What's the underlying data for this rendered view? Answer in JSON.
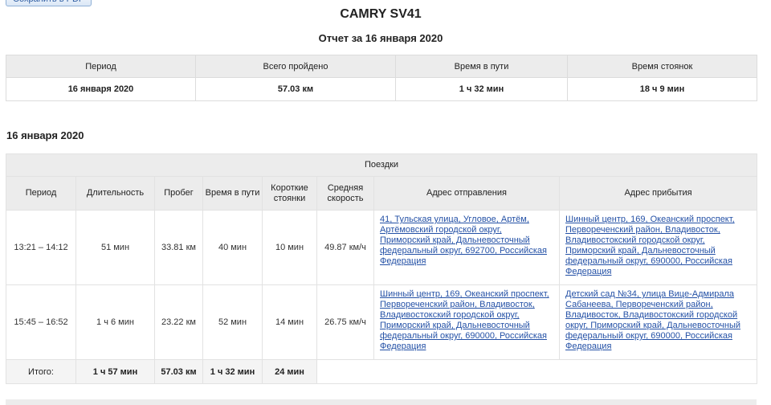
{
  "toolbar": {
    "pdf_button": "Сохранить в PDF"
  },
  "report": {
    "title": "CAMRY SV41",
    "subtitle": "Отчет за 16 января 2020"
  },
  "summary": {
    "headers": [
      "Период",
      "Всего пройдено",
      "Время в пути",
      "Время стоянок"
    ],
    "values": [
      "16 января 2020",
      "57.03 км",
      "1 ч 32 мин",
      "18 ч 9 мин"
    ]
  },
  "day": {
    "heading": "16 января 2020",
    "caption": "Поездки",
    "headers": [
      "Период",
      "Длительность",
      "Пробег",
      "Время в пути",
      "Короткие стоянки",
      "Средняя скорость",
      "Адрес отправления",
      "Адрес прибытия"
    ],
    "trips": [
      {
        "period": "13:21 – 14:12",
        "duration": "51 мин",
        "distance": "33.81 км",
        "drive_time": "40 мин",
        "short_stops": "10 мин",
        "avg_speed": "49.87 км/ч",
        "from": "41, Тульская улица, Угловое, Артём, Артёмовский городской округ, Приморский край, Дальневосточный федеральный округ, 692700, Российская Федерация",
        "to": "Шинный центр, 169, Океанский проспект, Первореченский район, Владивосток, Владивостокский городской округ, Приморский край, Дальневосточный федеральный округ, 690000, Российская Федерация"
      },
      {
        "period": "15:45 – 16:52",
        "duration": "1 ч 6 мин",
        "distance": "23.22 км",
        "drive_time": "52 мин",
        "short_stops": "14 мин",
        "avg_speed": "26.75 км/ч",
        "from": "Шинный центр, 169, Океанский проспект, Первореченский район, Владивосток, Владивостокский городской округ, Приморский край, Дальневосточный федеральный округ, 690000, Российская Федерация",
        "to": "Детский сад №34, улица Вице-Адмирала Сабанеева, Первореченский район, Владивосток, Владивостокский городской округ, Приморский край, Дальневосточный федеральный округ, 690000, Российская Федерация"
      }
    ],
    "totals": {
      "label": "Итого:",
      "duration": "1 ч 57 мин",
      "distance": "57.03 км",
      "drive_time": "1 ч 32 мин",
      "short_stops": "24 мин"
    }
  }
}
